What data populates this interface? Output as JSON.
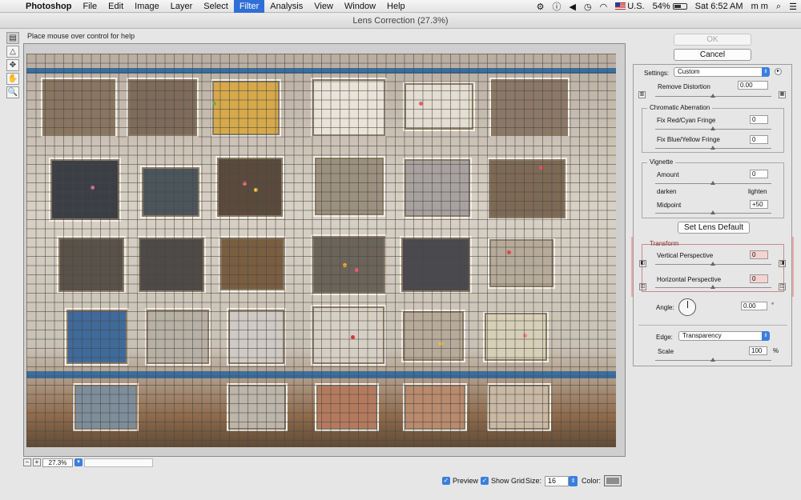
{
  "menubar": {
    "app_name": "Photoshop",
    "items": [
      "File",
      "Edit",
      "Image",
      "Layer",
      "Select",
      "Filter",
      "Analysis",
      "View",
      "Window",
      "Help"
    ],
    "active": "Filter",
    "status": {
      "input_source": "U.S.",
      "battery": "54%",
      "clock": "Sat 6:52 AM",
      "user": "m m"
    }
  },
  "window": {
    "title": "Lens Correction (27.3%)"
  },
  "help_text": "Place mouse over control for help",
  "zoom": {
    "value": "27.3%"
  },
  "buttons": {
    "ok": "OK",
    "cancel": "Cancel",
    "set_lens_default": "Set Lens Default"
  },
  "settings": {
    "label": "Settings:",
    "value": "Custom",
    "remove_distortion": {
      "label": "Remove Distortion",
      "value": "0.00"
    }
  },
  "chromatic": {
    "title": "Chromatic Aberration",
    "red_cyan": {
      "label": "Fix Red/Cyan Fringe",
      "value": "0"
    },
    "blue_yellow": {
      "label": "Fix Blue/Yellow Fringe",
      "value": "0"
    }
  },
  "vignette": {
    "title": "Vignette",
    "amount": {
      "label": "Amount",
      "value": "0"
    },
    "darken": "darken",
    "lighten": "lighten",
    "midpoint": {
      "label": "Midpoint",
      "value": "+50"
    }
  },
  "transform": {
    "title": "Transform",
    "vertical": {
      "label": "Vertical Perspective",
      "value": "0"
    },
    "horizontal": {
      "label": "Horizontal Perspective",
      "value": "0"
    },
    "angle": {
      "label": "Angle:",
      "value": "0.00",
      "unit": "°"
    }
  },
  "edge": {
    "label": "Edge:",
    "value": "Transparency"
  },
  "scale": {
    "label": "Scale",
    "value": "100",
    "unit": "%"
  },
  "bottom": {
    "preview": "Preview",
    "show_grid": "Show Grid",
    "size_label": "Size:",
    "size_value": "16",
    "color_label": "Color:"
  },
  "colors": {
    "highlight": "#f07878",
    "accent": "#3b7fdd",
    "active_menu": "#2f6fd6"
  }
}
